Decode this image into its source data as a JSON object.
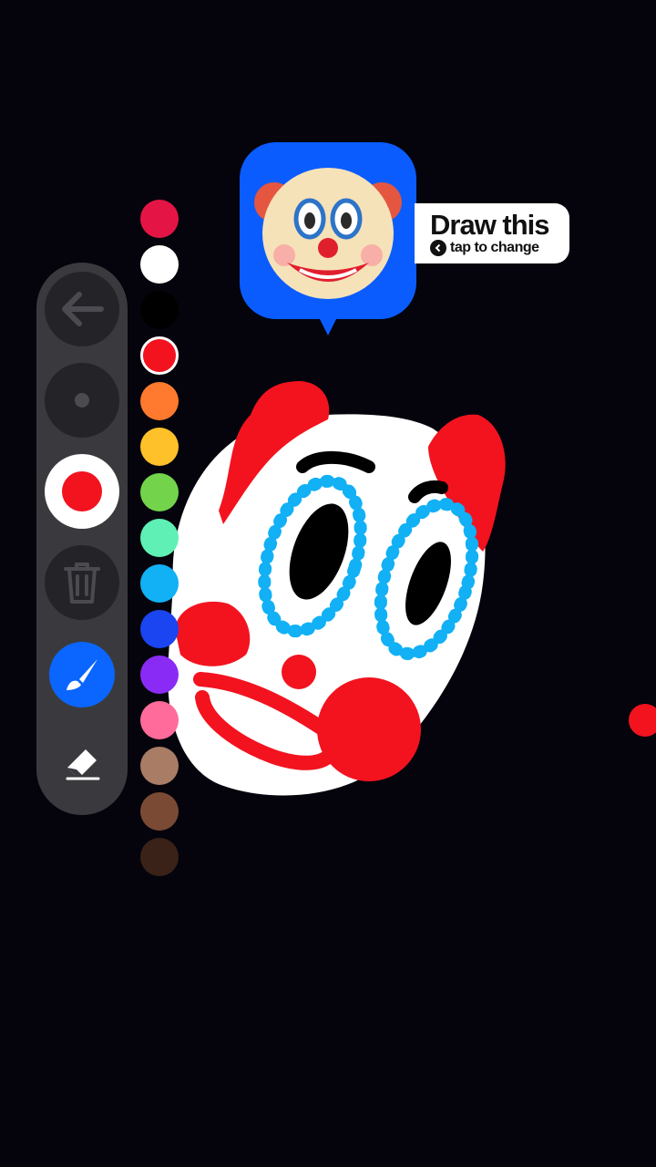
{
  "prompt": {
    "title": "Draw this",
    "subtitle": "tap to change",
    "emoji_icon": "clown-face-icon"
  },
  "toolbar": {
    "tools": [
      {
        "name": "back-button",
        "icon": "arrow-left-icon"
      },
      {
        "name": "brush-size-small-button",
        "icon": "small-dot-icon"
      },
      {
        "name": "brush-size-large-button",
        "icon": "large-dot-icon",
        "selected": true,
        "color": "#f2131f"
      },
      {
        "name": "clear-button",
        "icon": "trash-icon"
      },
      {
        "name": "brush-tool-button",
        "icon": "paintbrush-icon",
        "selected": true
      },
      {
        "name": "eraser-tool-button",
        "icon": "eraser-icon"
      }
    ]
  },
  "palette": {
    "colors": [
      "#e41545",
      "#ffffff",
      "#000000",
      "#f2131f",
      "#ff7a2e",
      "#ffc12a",
      "#73d44b",
      "#5ef0b4",
      "#12b0f5",
      "#1a45f0",
      "#8a2bf5",
      "#ff6b9a",
      "#a87c65",
      "#7a4a35",
      "#3a2218"
    ],
    "selected": "#f2131f"
  },
  "drawing": {
    "colors": {
      "fill": "#ffffff",
      "hair": "#f2131f",
      "eyes": "#12b0f5",
      "pupil": "#000000",
      "cheek": "#f2131f"
    }
  }
}
